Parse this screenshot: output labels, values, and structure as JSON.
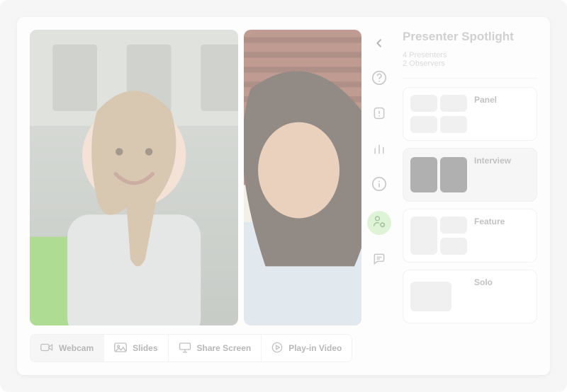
{
  "panel": {
    "title": "Presenter Spotlight",
    "presenters": "4 Presenters",
    "observers": "2 Observers"
  },
  "layouts": {
    "panel": "Panel",
    "interview": "Interview",
    "feature": "Feature",
    "solo": "Solo"
  },
  "toolbar": {
    "webcam": "Webcam",
    "slides": "Slides",
    "share": "Share Screen",
    "playin": "Play-in Video"
  }
}
